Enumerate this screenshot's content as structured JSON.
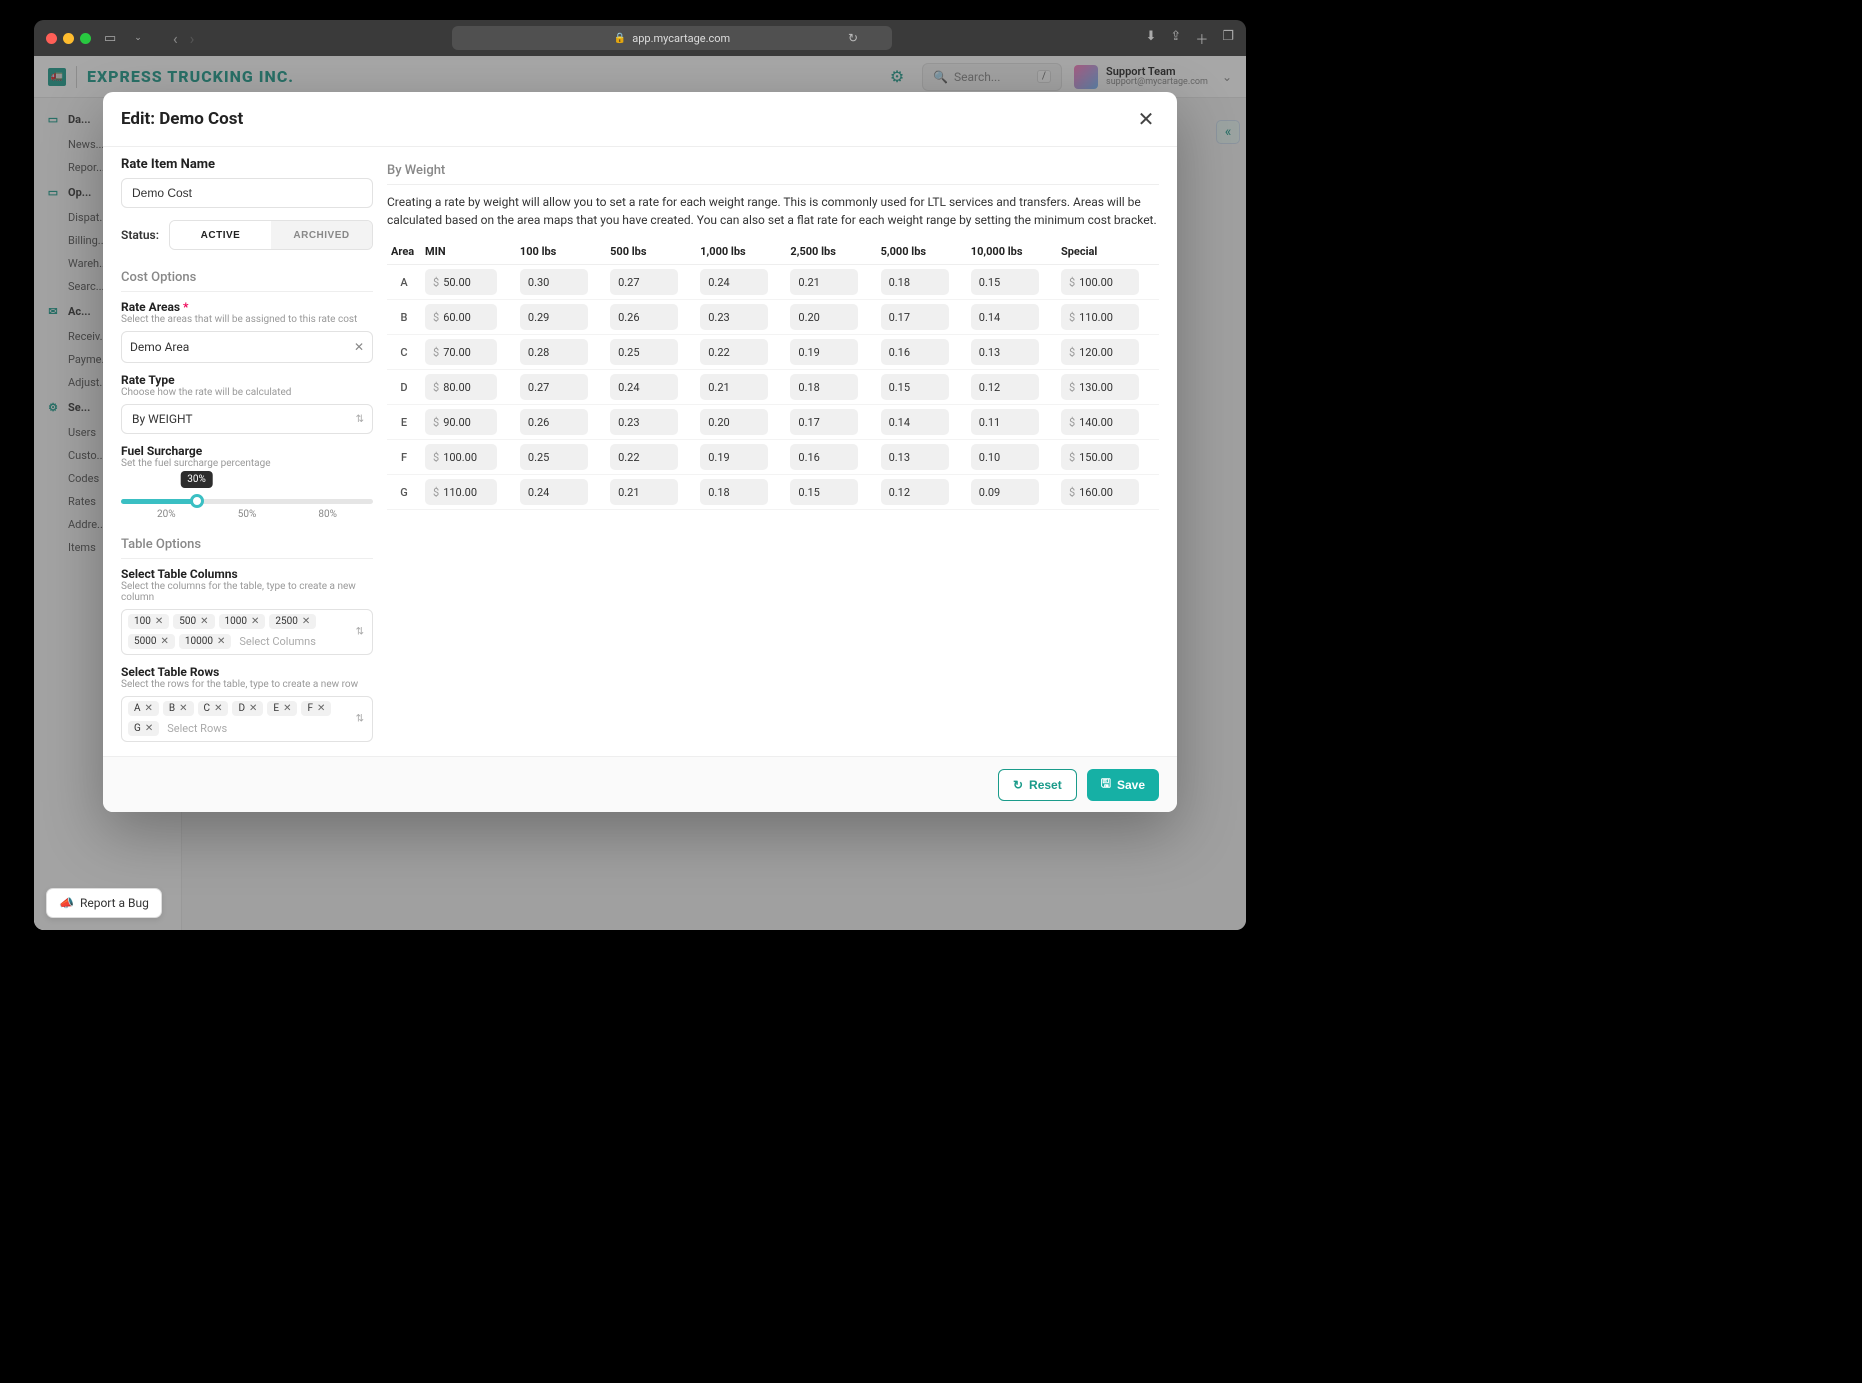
{
  "browser": {
    "url_host": "app.mycartage.com"
  },
  "header": {
    "company": "EXPRESS TRUCKING INC.",
    "search_placeholder": "Search...",
    "kbd": "/",
    "user_name": "Support Team",
    "user_email": "support@mycartage.com"
  },
  "sidebar": {
    "groups": [
      {
        "icon": "▭",
        "label": "Da...",
        "items": [
          "News...",
          "Repor..."
        ]
      },
      {
        "icon": "▭",
        "label": "Op...",
        "items": [
          "Dispat...",
          "Billing...",
          "Wareh...",
          "Searc..."
        ]
      },
      {
        "icon": "✉",
        "label": "Ac...",
        "items": [
          "Receiv...",
          "Payme...",
          "Adjust..."
        ]
      },
      {
        "icon": "⚙",
        "label": "Se...",
        "items": [
          "Users",
          "Custo...",
          "Codes",
          "Rates",
          "Addre...",
          "Items"
        ]
      }
    ]
  },
  "modal": {
    "title": "Edit: Demo Cost",
    "left": {
      "name_label": "Rate Item Name",
      "name_value": "Demo Cost",
      "status_label": "Status:",
      "status_active": "ACTIVE",
      "status_archived": "ARCHIVED",
      "cost_options_h": "Cost Options",
      "rate_areas_label": "Rate Areas",
      "rate_areas_sub": "Select the areas that will be assigned to this rate cost",
      "rate_areas_value": "Demo Area",
      "rate_type_label": "Rate Type",
      "rate_type_sub": "Choose how the rate will be calculated",
      "rate_type_value": "By WEIGHT",
      "fuel_label": "Fuel Surcharge",
      "fuel_sub": "Set the fuel surcharge percentage",
      "fuel_value": "30%",
      "ticks": {
        "a": "20%",
        "b": "50%",
        "c": "80%"
      },
      "table_options_h": "Table Options",
      "cols_label": "Select Table Columns",
      "cols_sub": "Select the columns for the table, type to create a new column",
      "cols": [
        "100",
        "500",
        "1000",
        "2500",
        "5000",
        "10000"
      ],
      "cols_placeholder": "Select Columns",
      "rows_label": "Select Table Rows",
      "rows_sub": "Select the rows for the table, type to create a new row",
      "rows": [
        "A",
        "B",
        "C",
        "D",
        "E",
        "F",
        "G"
      ],
      "rows_placeholder": "Select Rows"
    },
    "right": {
      "heading": "By Weight",
      "desc": "Creating a rate by weight will allow you to set a rate for each weight range. This is commonly used for LTL services and transfers. Areas will be calculated based on the area maps that you have created. You can also set a flat rate for each weight range by setting the minimum cost bracket.",
      "cols": [
        "Area",
        "MIN",
        "100 lbs",
        "500 lbs",
        "1,000 lbs",
        "2,500 lbs",
        "5,000 lbs",
        "10,000 lbs",
        "Special"
      ],
      "rows": [
        {
          "area": "A",
          "min": "50.00",
          "r": [
            "0.30",
            "0.27",
            "0.24",
            "0.21",
            "0.18",
            "0.15"
          ],
          "sp": "100.00"
        },
        {
          "area": "B",
          "min": "60.00",
          "r": [
            "0.29",
            "0.26",
            "0.23",
            "0.20",
            "0.17",
            "0.14"
          ],
          "sp": "110.00"
        },
        {
          "area": "C",
          "min": "70.00",
          "r": [
            "0.28",
            "0.25",
            "0.22",
            "0.19",
            "0.16",
            "0.13"
          ],
          "sp": "120.00"
        },
        {
          "area": "D",
          "min": "80.00",
          "r": [
            "0.27",
            "0.24",
            "0.21",
            "0.18",
            "0.15",
            "0.12"
          ],
          "sp": "130.00"
        },
        {
          "area": "E",
          "min": "90.00",
          "r": [
            "0.26",
            "0.23",
            "0.20",
            "0.17",
            "0.14",
            "0.11"
          ],
          "sp": "140.00"
        },
        {
          "area": "F",
          "min": "100.00",
          "r": [
            "0.25",
            "0.22",
            "0.19",
            "0.16",
            "0.13",
            "0.10"
          ],
          "sp": "150.00"
        },
        {
          "area": "G",
          "min": "110.00",
          "r": [
            "0.24",
            "0.21",
            "0.18",
            "0.15",
            "0.12",
            "0.09"
          ],
          "sp": "160.00"
        }
      ]
    },
    "footer": {
      "reset": "Reset",
      "save": "Save"
    }
  },
  "report_bug": "Report a Bug"
}
